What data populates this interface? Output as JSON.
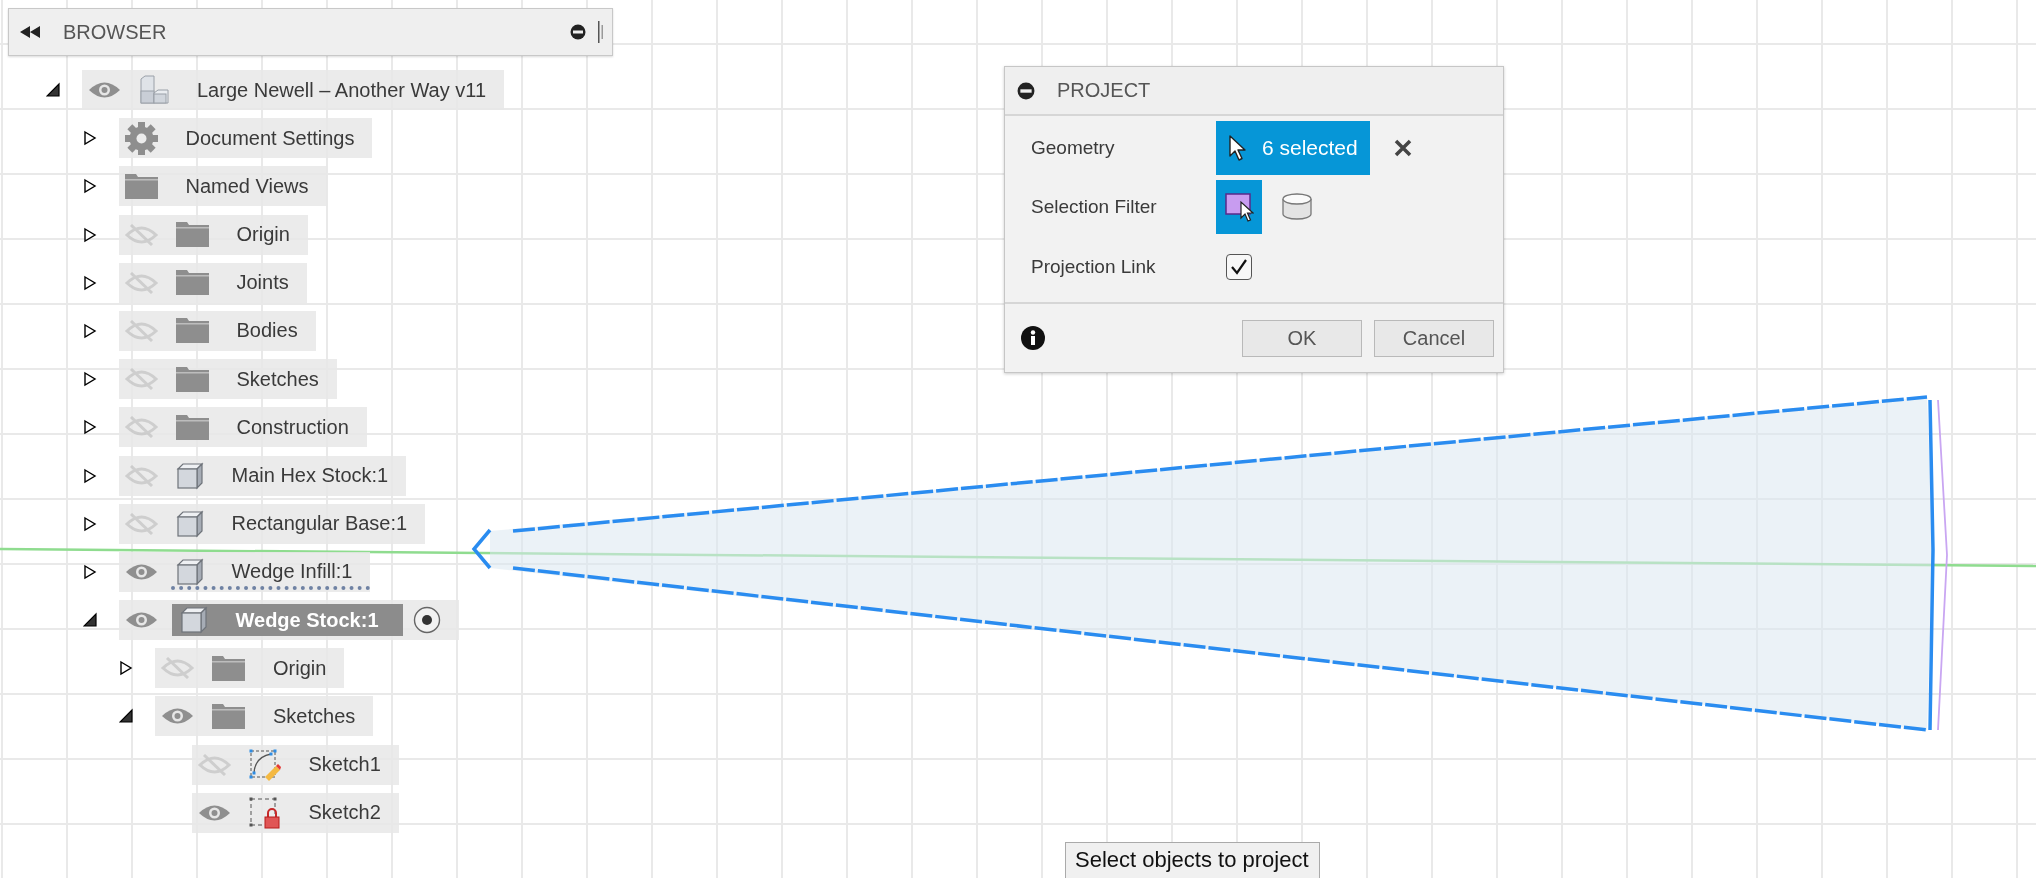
{
  "browser": {
    "title": "BROWSER",
    "tree": [
      {
        "label": "Large Newell – Another Way v11",
        "kind": "component",
        "visible": true,
        "expanded": true,
        "selected": false,
        "active": false,
        "marked": false,
        "children": [
          {
            "label": "Document Settings",
            "kind": "settings",
            "expanded": false,
            "selected": false,
            "active": false,
            "marked": false
          },
          {
            "label": "Named Views",
            "kind": "folder",
            "expanded": false,
            "selected": false,
            "active": false,
            "marked": false
          },
          {
            "label": "Origin",
            "kind": "folder",
            "visible": false,
            "expanded": false,
            "selected": false,
            "active": false,
            "marked": false
          },
          {
            "label": "Joints",
            "kind": "folder",
            "visible": false,
            "expanded": false,
            "selected": false,
            "active": false,
            "marked": false
          },
          {
            "label": "Bodies",
            "kind": "folder",
            "visible": false,
            "expanded": false,
            "selected": false,
            "active": false,
            "marked": false
          },
          {
            "label": "Sketches",
            "kind": "folder",
            "visible": false,
            "expanded": false,
            "selected": false,
            "active": false,
            "marked": false
          },
          {
            "label": "Construction",
            "kind": "folder",
            "visible": false,
            "expanded": false,
            "selected": false,
            "active": false,
            "marked": false
          },
          {
            "label": "Main Hex Stock:1",
            "kind": "body",
            "visible": false,
            "expanded": false,
            "selected": false,
            "active": false,
            "marked": false
          },
          {
            "label": "Rectangular Base:1",
            "kind": "body",
            "visible": false,
            "expanded": false,
            "selected": false,
            "active": false,
            "marked": false
          },
          {
            "label": "Wedge Infill:1",
            "kind": "body",
            "visible": true,
            "expanded": false,
            "selected": false,
            "active": false,
            "marked": true
          },
          {
            "label": "Wedge Stock:1",
            "kind": "body",
            "visible": true,
            "expanded": true,
            "selected": true,
            "active": true,
            "marked": false,
            "children": [
              {
                "label": "Origin",
                "kind": "folder",
                "visible": false,
                "expanded": false,
                "selected": false,
                "active": false,
                "marked": false
              },
              {
                "label": "Sketches",
                "kind": "folder",
                "visible": true,
                "expanded": true,
                "selected": false,
                "active": false,
                "marked": false,
                "children": [
                  {
                    "label": "Sketch1",
                    "kind": "sketch",
                    "visible": false,
                    "selected": false,
                    "active": false,
                    "marked": false
                  },
                  {
                    "label": "Sketch2",
                    "kind": "sketch-locked",
                    "visible": true,
                    "selected": false,
                    "active": false,
                    "marked": false
                  }
                ]
              }
            ]
          }
        ]
      }
    ]
  },
  "dialog": {
    "title": "PROJECT",
    "rows": [
      {
        "kind": "selection",
        "label": "Geometry",
        "value": "6 selected"
      },
      {
        "kind": "filter",
        "label": "Selection Filter",
        "options": [
          {
            "kind": "face",
            "selected": true
          },
          {
            "kind": "body",
            "selected": false
          }
        ]
      },
      {
        "kind": "checkbox",
        "label": "Projection Link",
        "checked": true
      }
    ],
    "buttons": [
      "OK",
      "Cancel"
    ]
  },
  "hint": "Select objects to project"
}
